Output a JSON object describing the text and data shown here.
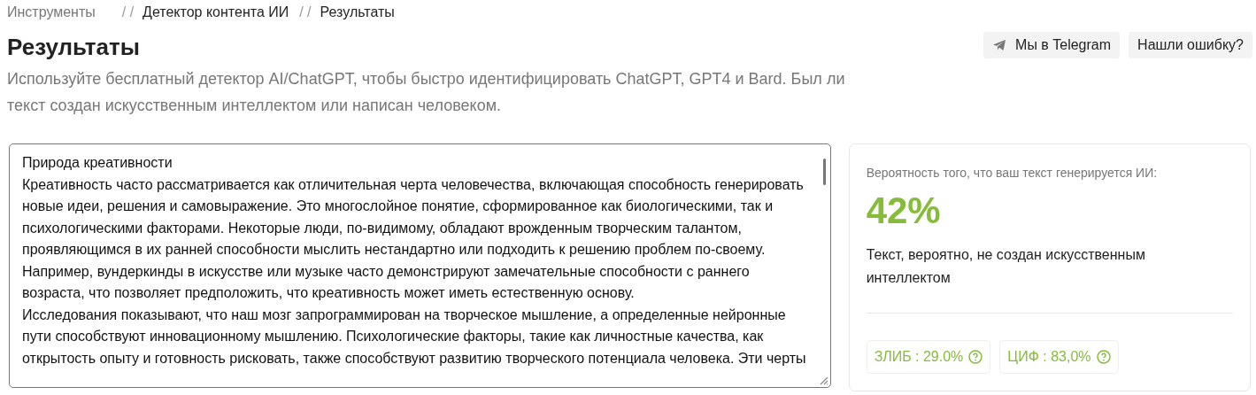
{
  "breadcrumb": [
    {
      "kind": "muted",
      "label": "Инструменты"
    },
    {
      "kind": "separator",
      "label": "/ /"
    },
    {
      "kind": "link",
      "label": "Детектор контента ИИ"
    },
    {
      "kind": "separator",
      "label": "/ /"
    },
    {
      "kind": "current",
      "label": "Результаты"
    }
  ],
  "title": "Результаты",
  "description": "Используйте бесплатный детектор AI/ChatGPT, чтобы быстро идентифицировать ChatGPT, GPT4 и Bard. Был ли текст создан искусственным интеллектом или написан человеком.",
  "buttons": [
    {
      "kind": "telegram",
      "label": "Мы в Telegram"
    },
    {
      "kind": "plain",
      "label": "Нашли ошибку?"
    }
  ],
  "text_field": {
    "paragraphs": [
      "Природа креативности",
      "Креативность часто рассматривается как отличительная черта человечества, включающая способность генерировать новые идеи, решения и самовыражение. Это многослойное понятие, сформированное как биологическими, так и психологическими факторами. Некоторые люди, по-видимому, обладают врожденным творческим талантом, проявляющимся в их ранней способности мыслить нестандартно или подходить к решению проблем по-своему. Например, вундеркинды в искусстве или музыке часто демонстрируют замечательные способности с раннего возраста, что позволяет предположить, что креативность может иметь естественную основу.",
      "Исследования показывают, что наш мозг запрограммирован на творческое мышление, а определенные нейронные пути способствуют инновационному мышлению. Психологические факторы, такие как личностные качества, как открытость опыту и готовность рисковать, также способствуют развитию творческого потенциала человека. Эти черты"
    ]
  },
  "result": {
    "label": "Вероятность того, что ваш текст генерируется ИИ:",
    "score": "42%",
    "color": "#86bc3a",
    "verdict": "Текст, вероятно, не создан искусственным интеллектом",
    "metrics": [
      {
        "label": "ЗЛИБ : 29.0%"
      },
      {
        "label": "ЦИФ : 83,0%"
      }
    ]
  }
}
